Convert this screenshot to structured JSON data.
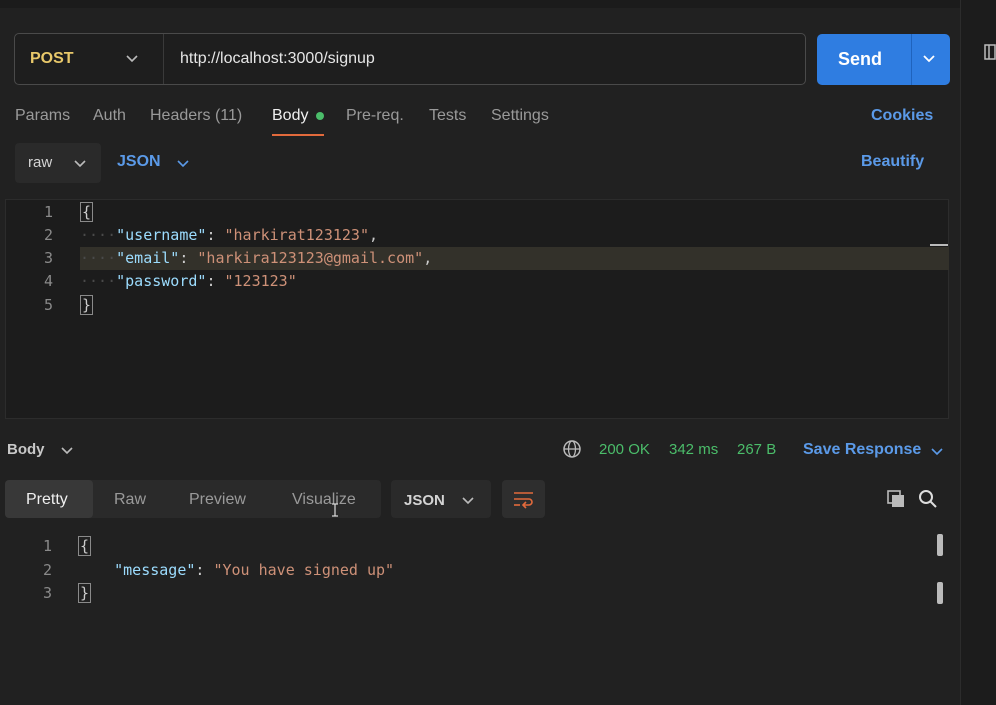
{
  "request": {
    "method": "POST",
    "url": "http://localhost:3000/signup",
    "send_label": "Send"
  },
  "request_tabs": [
    {
      "label": "Params"
    },
    {
      "label": "Auth"
    },
    {
      "label": "Headers"
    },
    {
      "label": "Body"
    },
    {
      "label": "Pre-req."
    },
    {
      "label": "Tests"
    },
    {
      "label": "Settings"
    }
  ],
  "headers_count": "(11)",
  "cookies_label": "Cookies",
  "body_mode": {
    "type": "raw",
    "format": "JSON",
    "beautify_label": "Beautify"
  },
  "editor": {
    "line_numbers": [
      "1",
      "2",
      "3",
      "4",
      "5"
    ],
    "open_brace": "{",
    "close_brace": "}",
    "fields": [
      {
        "key": "\"username\"",
        "value": "\"harkirat123123\"",
        "comma": ","
      },
      {
        "key": "\"email\"",
        "value": "\"harkira123123@gmail.com\"",
        "comma": ","
      },
      {
        "key": "\"password\"",
        "value": "\"123123\"",
        "comma": ""
      }
    ]
  },
  "response": {
    "section_label": "Body",
    "status": "200 OK",
    "time": "342 ms",
    "size": "267 B",
    "save_label": "Save Response",
    "view_tabs": [
      {
        "label": "Pretty"
      },
      {
        "label": "Raw"
      },
      {
        "label": "Preview"
      },
      {
        "label": "Visualize"
      }
    ],
    "format": "JSON",
    "line_numbers": [
      "1",
      "2",
      "3"
    ],
    "open_brace": "{",
    "close_brace": "}",
    "key": "\"message\"",
    "value": "\"You have signed up\""
  },
  "colors": {
    "accent_blue": "#2f7de1",
    "link_blue": "#5b9ae8",
    "status_green": "#4bbd6a",
    "method_yellow": "#e8c86a",
    "tab_underline": "#e26a3c"
  }
}
